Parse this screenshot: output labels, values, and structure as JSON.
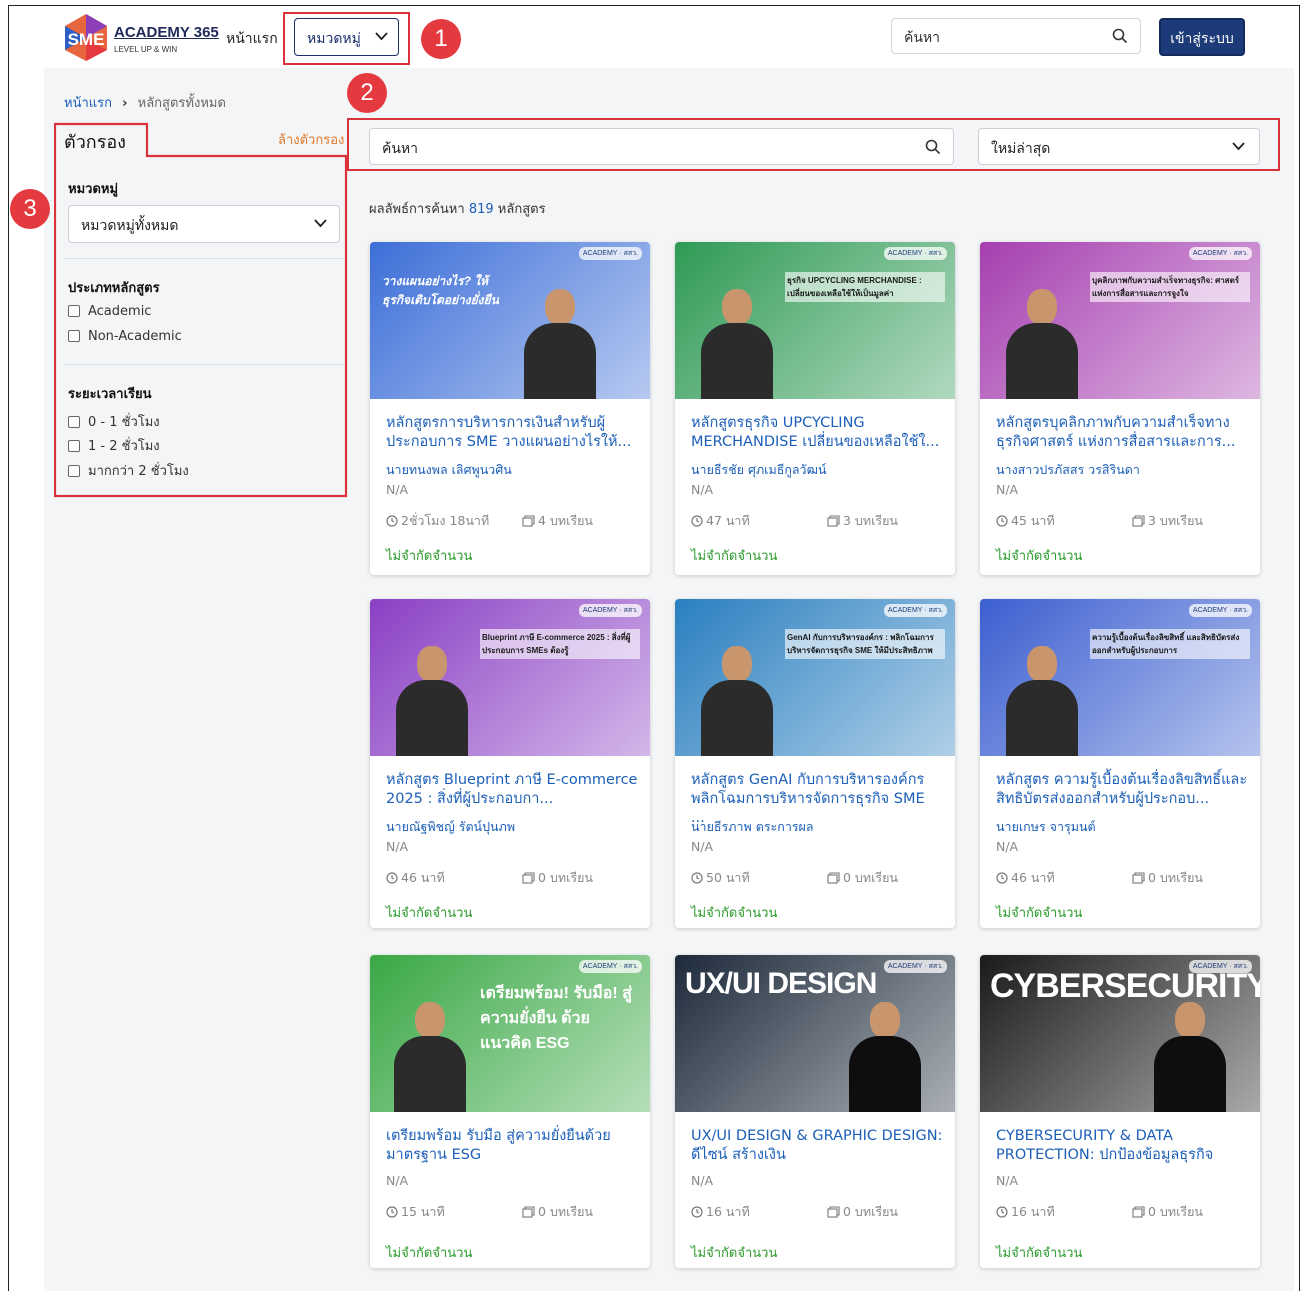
{
  "header": {
    "logo_text": "ACADEMY 365",
    "logo_sub": "LEVEL UP & WIN",
    "logo_mark": "SME",
    "nav_home": "หน้าแรก",
    "nav_category": "หมวดหมู่",
    "search_placeholder": "ค้นหา",
    "login": "เข้าสู่ระบบ"
  },
  "badges": [
    "1",
    "2",
    "3"
  ],
  "breadcrumb": {
    "home": "หน้าแรก",
    "current": "หลักสูตรทั้งหมด"
  },
  "sidebar": {
    "title": "ตัวกรอง",
    "clear": "ล้างตัวกรอง",
    "category_title": "หมวดหมู่",
    "category_value": "หมวดหมู่ทั้งหมด",
    "type_title": "ประเภทหลักสูตร",
    "types": [
      "Academic",
      "Non-Academic"
    ],
    "duration_title": "ระยะเวลาเรียน",
    "durations": [
      "0 - 1 ชั่วโมง",
      "1 - 2 ชั่วโมง",
      "มากกว่า 2 ชั่วโมง"
    ]
  },
  "main": {
    "search_placeholder": "ค้นหา",
    "sort_value": "ใหม่ล่าสุด",
    "result_prefix": "ผลลัพธ์การค้นหา",
    "result_count": "819",
    "result_suffix": "หลักสูตร"
  },
  "cards": [
    {
      "title": "หลักสูตรการบริหารการเงินสำหรับผู้ประกอบการ SME วางแผนอย่างไรให้...",
      "author": "นายทนงพล เลิศพูนวศิน",
      "na": "N/A",
      "duration": "2ชั่วโมง 18นาที",
      "lessons": "4 บทเรียน",
      "limit": "ไม่จำกัดจำนวน",
      "thumb_text": "วางแผนอย่างไร? ให้ธุรกิจเติบโตอย่างยั่งยืน",
      "thumb_color": "#3d6fd8"
    },
    {
      "title": "หลักสูตรธุรกิจ UPCYCLING MERCHANDISE เปลี่ยนของเหลือใช้ใ...",
      "author": "นายธีรชัย ศุภเมธีกูลวัฒน์",
      "na": "N/A",
      "duration": "47 นาที",
      "lessons": "3 บทเรียน",
      "limit": "ไม่จำกัดจำนวน",
      "thumb_text": "ธุรกิจ UPCYCLING MERCHANDISE : เปลี่ยนของเหลือใช้ให้เป็นมูลค่า",
      "thumb_color": "#2f9a55"
    },
    {
      "title": "หลักสูตรบุคลิกภาพกับความสำเร็จทางธุรกิจศาสตร์ แห่งการสื่อสารและการ...",
      "author": "นางสาวปรภัสสร วรสิรินดา",
      "na": "N/A",
      "duration": "45 นาที",
      "lessons": "3 บทเรียน",
      "limit": "ไม่จำกัดจำนวน",
      "thumb_text": "บุคลิกภาพกับความสำเร็จทางธุรกิจ: ศาสตร์แห่งการสื่อสารและการจูงใจ",
      "thumb_color": "#a63fb0"
    },
    {
      "title": "หลักสูตร Blueprint ภาษี E-commerce 2025 : สิ่งที่ผู้ประกอบกา...",
      "author": "นายณัฐพิชญ์ รัตน์ปุนภพ",
      "na": "N/A",
      "duration": "46 นาที",
      "lessons": "0 บทเรียน",
      "limit": "ไม่จำกัดจำนวน",
      "thumb_text": "Blueprint ภาษี E-commerce 2025 : สิ่งที่ผู้ประกอบการ SMEs ต้องรู้",
      "thumb_color": "#8a3fc4"
    },
    {
      "title": "หลักสูตร GenAI กับการบริหารองค์กร พลิกโฉมการบริหารจัดการธุรกิจ SME ...",
      "author": "นายธีรภาพ ตระการผล",
      "na": "N/A",
      "duration": "50 นาที",
      "lessons": "0 บทเรียน",
      "limit": "ไม่จำกัดจำนวน",
      "thumb_text": "GenAI กับการบริหารองค์กร : พลิกโฉมการบริหารจัดการธุรกิจ SME ให้มีประสิทธิภาพ",
      "thumb_color": "#2a7fc0"
    },
    {
      "title": "หลักสูตร ความรู้เบื้องต้นเรื่องลิขสิทธิ์และสิทธิบัตรส่งออกสำหรับผู้ประกอบ...",
      "author": "นายเกษร จารุมนต์",
      "na": "N/A",
      "duration": "46 นาที",
      "lessons": "0 บทเรียน",
      "limit": "ไม่จำกัดจำนวน",
      "thumb_text": "ความรู้เบื้องต้นเรื่องลิขสิทธิ์ และสิทธิบัตรส่งออกสำหรับผู้ประกอบการ",
      "thumb_color": "#3b5fd0"
    },
    {
      "title": "เตรียมพร้อม รับมือ สู่ความยั่งยืนด้วยมาตรฐาน ESG",
      "author": "",
      "na": "N/A",
      "duration": "15 นาที",
      "lessons": "0 บทเรียน",
      "limit": "ไม่จำกัดจำนวน",
      "thumb_text": "เตรียมพร้อม! รับมือ! สู่ความยั่งยืน ด้วยแนวคิด ESG",
      "thumb_color": "#3aa845"
    },
    {
      "title": "UX/UI DESIGN & GRAPHIC DESIGN: ดีไซน์ สร้างเงิน",
      "author": "",
      "na": "N/A",
      "duration": "16 นาที",
      "lessons": "0 บทเรียน",
      "limit": "ไม่จำกัดจำนวน",
      "thumb_text": "UX/UI DESIGN",
      "thumb_color": "#1d2a3a"
    },
    {
      "title": "CYBERSECURITY & DATA PROTECTION: ปกป้องข้อมูลธุรกิจ",
      "author": "",
      "na": "N/A",
      "duration": "16 นาที",
      "lessons": "0 บทเรียน",
      "limit": "ไม่จำกัดจำนวน",
      "thumb_text": "CYBERSECURITY",
      "thumb_color": "#1a1a1a"
    }
  ],
  "colors": {
    "accent": "#1c5fb8",
    "login_bg": "#1c3b78",
    "highlight": "#d9323a",
    "limit": "#2a9a2a",
    "clear": "#e07a2b"
  },
  "icons": [
    "search-icon",
    "chevron-down-icon",
    "clock-icon",
    "lessons-icon",
    "checkbox-icon"
  ]
}
